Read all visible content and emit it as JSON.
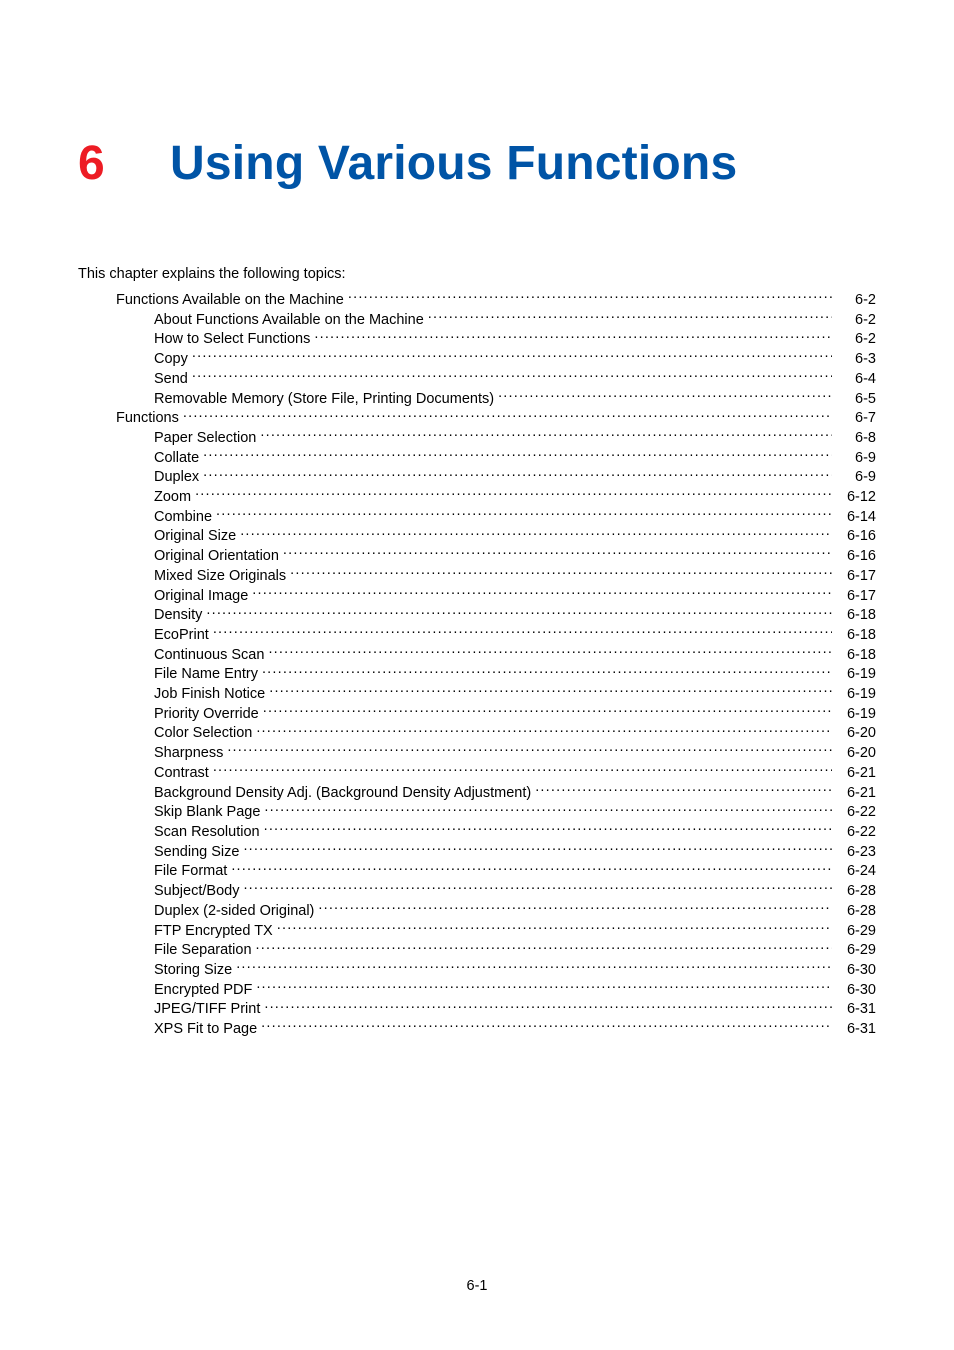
{
  "chapter_number": "6",
  "chapter_title": "Using Various Functions",
  "intro": "This chapter explains the following topics:",
  "toc": [
    {
      "label": "Functions Available on the Machine",
      "page": "6-2",
      "indent": 0
    },
    {
      "label": "About Functions Available on the Machine",
      "page": "6-2",
      "indent": 1
    },
    {
      "label": "How to Select Functions",
      "page": "6-2",
      "indent": 1
    },
    {
      "label": "Copy",
      "page": "6-3",
      "indent": 1
    },
    {
      "label": "Send",
      "page": "6-4",
      "indent": 1
    },
    {
      "label": "Removable Memory (Store File, Printing Documents)",
      "page": "6-5",
      "indent": 1
    },
    {
      "label": "Functions",
      "page": "6-7",
      "indent": 0
    },
    {
      "label": "Paper Selection",
      "page": "6-8",
      "indent": 1
    },
    {
      "label": "Collate",
      "page": "6-9",
      "indent": 1
    },
    {
      "label": "Duplex",
      "page": "6-9",
      "indent": 1
    },
    {
      "label": "Zoom",
      "page": "6-12",
      "indent": 1
    },
    {
      "label": "Combine",
      "page": "6-14",
      "indent": 1
    },
    {
      "label": "Original Size",
      "page": "6-16",
      "indent": 1
    },
    {
      "label": "Original Orientation",
      "page": "6-16",
      "indent": 1
    },
    {
      "label": "Mixed Size Originals",
      "page": "6-17",
      "indent": 1
    },
    {
      "label": "Original Image",
      "page": "6-17",
      "indent": 1
    },
    {
      "label": "Density",
      "page": "6-18",
      "indent": 1
    },
    {
      "label": "EcoPrint",
      "page": "6-18",
      "indent": 1
    },
    {
      "label": "Continuous Scan",
      "page": "6-18",
      "indent": 1
    },
    {
      "label": "File Name Entry",
      "page": "6-19",
      "indent": 1
    },
    {
      "label": "Job Finish Notice",
      "page": "6-19",
      "indent": 1
    },
    {
      "label": "Priority Override",
      "page": "6-19",
      "indent": 1
    },
    {
      "label": "Color Selection",
      "page": "6-20",
      "indent": 1
    },
    {
      "label": "Sharpness",
      "page": "6-20",
      "indent": 1
    },
    {
      "label": "Contrast",
      "page": "6-21",
      "indent": 1
    },
    {
      "label": "Background Density Adj. (Background Density Adjustment)",
      "page": "6-21",
      "indent": 1
    },
    {
      "label": "Skip Blank Page",
      "page": "6-22",
      "indent": 1
    },
    {
      "label": "Scan Resolution",
      "page": "6-22",
      "indent": 1
    },
    {
      "label": "Sending Size",
      "page": "6-23",
      "indent": 1
    },
    {
      "label": "File Format",
      "page": "6-24",
      "indent": 1
    },
    {
      "label": "Subject/Body",
      "page": "6-28",
      "indent": 1
    },
    {
      "label": "Duplex (2-sided Original)",
      "page": "6-28",
      "indent": 1
    },
    {
      "label": "FTP Encrypted TX",
      "page": "6-29",
      "indent": 1
    },
    {
      "label": "File Separation",
      "page": "6-29",
      "indent": 1
    },
    {
      "label": "Storing Size",
      "page": "6-30",
      "indent": 1
    },
    {
      "label": "Encrypted PDF",
      "page": "6-30",
      "indent": 1
    },
    {
      "label": "JPEG/TIFF Print",
      "page": "6-31",
      "indent": 1
    },
    {
      "label": "XPS Fit to Page",
      "page": "6-31",
      "indent": 1
    }
  ],
  "page_number": "6-1"
}
